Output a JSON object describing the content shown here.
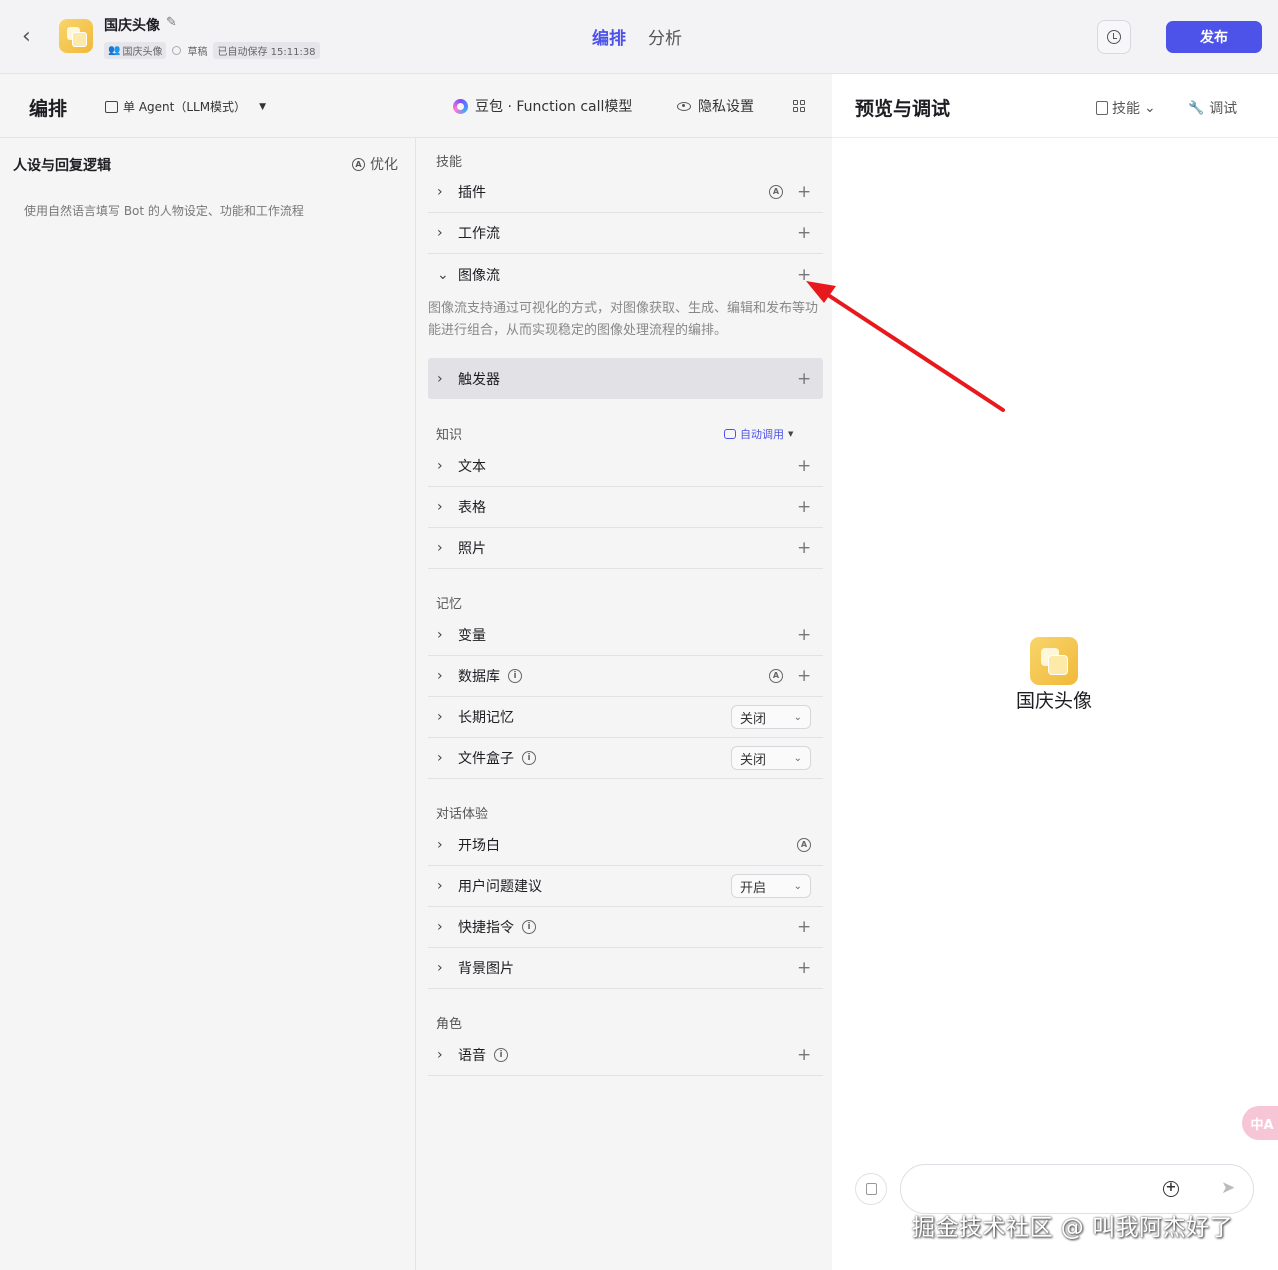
{
  "header": {
    "bot_name": "国庆头像",
    "owner_chip": "国庆头像",
    "status": "草稿",
    "autosave": "已自动保存 15:11:38",
    "tabs": [
      {
        "label": "编排",
        "active": true
      },
      {
        "label": "分析",
        "active": false
      }
    ],
    "publish_label": "发布"
  },
  "subbar": {
    "title": "编排",
    "agent_mode": "单 Agent（LLM模式）",
    "model": "豆包 · Function call模型",
    "privacy": "隐私设置"
  },
  "preview": {
    "title": "预览与调试",
    "skills_label": "技能",
    "debug_label": "调试",
    "bot_name": "国庆头像"
  },
  "persona": {
    "title": "人设与回复逻辑",
    "optimize_label": "优化",
    "placeholder": "使用自然语言填写 Bot 的人物设定、功能和工作流程"
  },
  "skills": {
    "section_label": "技能",
    "items": {
      "plugin": "插件",
      "workflow": "工作流",
      "imageflow": "图像流",
      "trigger": "触发器"
    },
    "imageflow_desc": "图像流支持通过可视化的方式，对图像获取、生成、编辑和发布等功能进行组合，从而实现稳定的图像处理流程的编排。"
  },
  "knowledge": {
    "section_label": "知识",
    "auto_call": "自动调用",
    "items": {
      "text": "文本",
      "table": "表格",
      "photo": "照片"
    }
  },
  "memory": {
    "section_label": "记忆",
    "items": {
      "variable": "变量",
      "database": "数据库",
      "longterm": "长期记忆",
      "filebox": "文件盒子"
    },
    "longterm_value": "关闭",
    "filebox_value": "关闭"
  },
  "dialog": {
    "section_label": "对话体验",
    "items": {
      "opening": "开场白",
      "suggestions": "用户问题建议",
      "shortcuts": "快捷指令",
      "background": "背景图片"
    },
    "suggestions_value": "开启"
  },
  "role": {
    "section_label": "角色",
    "items": {
      "voice": "语音"
    }
  },
  "icons": {
    "info_glyph": "i",
    "auto_glyph": "A",
    "plus_glyph": "+"
  },
  "misc": {
    "translate_fab": "中A",
    "watermark": "掘金技术社区 @ 叫我阿杰好了"
  },
  "colors": {
    "accent": "#4d53e8",
    "arrow": "#e8191c"
  }
}
